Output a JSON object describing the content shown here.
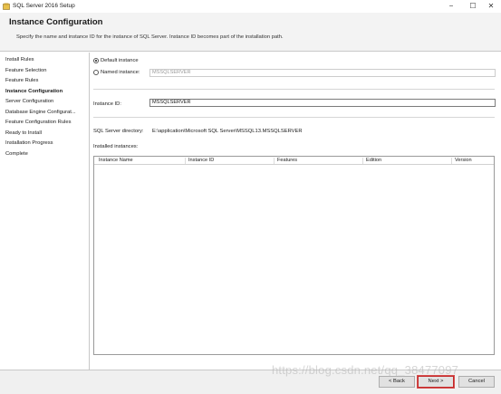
{
  "window": {
    "title": "SQL Server 2016 Setup",
    "controls": {
      "minimize": "−",
      "maximize": "☐",
      "close": "✕"
    },
    "icon": "sql-server-setup-icon"
  },
  "header": {
    "title": "Instance Configuration",
    "description": "Specify the name and instance ID for the instance of SQL Server. Instance ID becomes part of the installation path."
  },
  "sidebar": {
    "items": [
      {
        "label": "Install Rules",
        "active": false
      },
      {
        "label": "Feature Selection",
        "active": false
      },
      {
        "label": "Feature Rules",
        "active": false
      },
      {
        "label": "Instance Configuration",
        "active": true
      },
      {
        "label": "Server Configuration",
        "active": false
      },
      {
        "label": "Database Engine Configurat...",
        "active": false
      },
      {
        "label": "Feature Configuration Rules",
        "active": false
      },
      {
        "label": "Ready to Install",
        "active": false
      },
      {
        "label": "Installation Progress",
        "active": false
      },
      {
        "label": "Complete",
        "active": false
      }
    ]
  },
  "main": {
    "default_instance_label": "Default instance",
    "named_instance_label": "Named instance:",
    "named_instance_value": "MSSQLSERVER",
    "selected_option": "default",
    "instance_id_label": "Instance ID:",
    "instance_id_value": "MSSQLSERVER",
    "directory_label": "SQL Server directory:",
    "directory_value": "E:\\application\\Microsoft SQL Server\\MSSQL13.MSSQLSERVER",
    "installed_instances_label": "Installed instances:",
    "table": {
      "columns": [
        "Instance Name",
        "Instance ID",
        "Features",
        "Edition",
        "Version"
      ],
      "rows": []
    }
  },
  "footer": {
    "back_label": "< Back",
    "next_label": "Next >",
    "cancel_label": "Cancel"
  },
  "watermark": "https://blog.csdn.net/qq_38477097",
  "colors": {
    "header_bg": "#f3f3f3",
    "focus_border": "#c32a2a"
  }
}
